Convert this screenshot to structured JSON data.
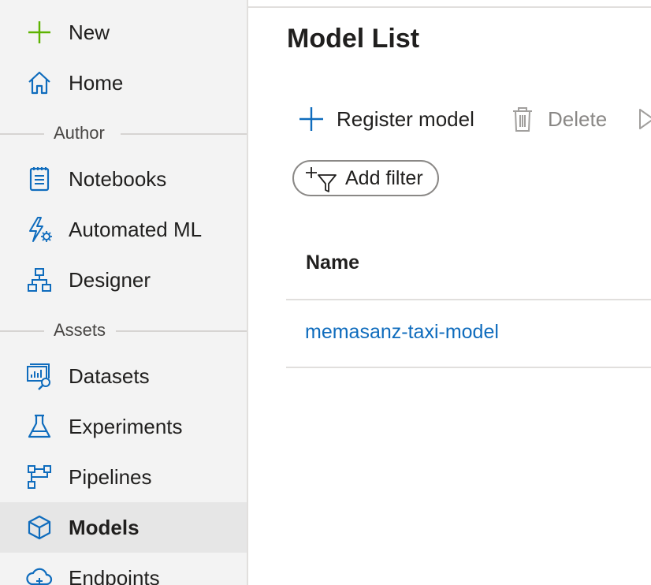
{
  "sidebar": {
    "new": {
      "label": "New",
      "icon": "plus-icon"
    },
    "home": {
      "label": "Home",
      "icon": "home-icon"
    },
    "sections": {
      "author": "Author",
      "assets": "Assets"
    },
    "author_items": [
      {
        "label": "Notebooks",
        "icon": "notebook-icon"
      },
      {
        "label": "Automated ML",
        "icon": "automated-ml-icon"
      },
      {
        "label": "Designer",
        "icon": "designer-icon"
      }
    ],
    "asset_items": [
      {
        "label": "Datasets",
        "icon": "dataset-icon"
      },
      {
        "label": "Experiments",
        "icon": "flask-icon"
      },
      {
        "label": "Pipelines",
        "icon": "pipeline-icon"
      },
      {
        "label": "Models",
        "icon": "cube-icon",
        "selected": true
      },
      {
        "label": "Endpoints",
        "icon": "cloud-endpoint-icon"
      }
    ]
  },
  "main": {
    "title": "Model List",
    "toolbar": {
      "register_label": "Register model",
      "delete_label": "Delete"
    },
    "filter": {
      "label": "Add filter"
    },
    "table": {
      "columns": [
        "Name"
      ],
      "rows": [
        {
          "name": "memasanz-taxi-model"
        }
      ]
    }
  },
  "colors": {
    "accent_blue": "#0f6cbd",
    "plus_green": "#5db300",
    "sidebar_bg": "#f3f3f3",
    "selected_bg": "#e6e6e6",
    "disabled_text": "#8a8886"
  }
}
